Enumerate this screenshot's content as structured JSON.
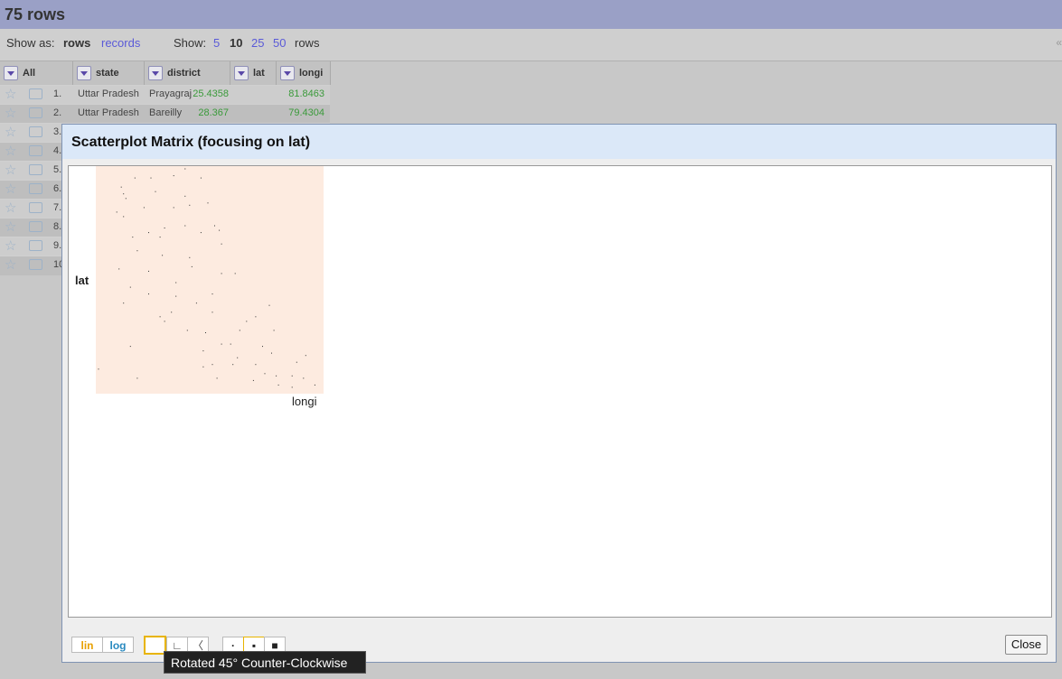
{
  "header": {
    "row_count": "75 rows"
  },
  "toolbar": {
    "show_as_label": "Show as:",
    "show_as_rows": "rows",
    "show_as_records": "records",
    "show_label": "Show:",
    "page_sizes": [
      "5",
      "10",
      "25",
      "50"
    ],
    "page_size_current": "10",
    "rows_suffix": "rows",
    "collapse_glyph": "«"
  },
  "table": {
    "columns": [
      "All",
      "state",
      "district",
      "lat",
      "longi"
    ],
    "visible_index_labels": [
      "1.",
      "2.",
      "3.",
      "4.",
      "5.",
      "6.",
      "7.",
      "8.",
      "9.",
      "10"
    ],
    "rows": [
      {
        "state": "Uttar Pradesh",
        "district": "Prayagraj",
        "lat": "25.4358",
        "longi": "81.8463"
      },
      {
        "state": "Uttar Pradesh",
        "district": "Bareilly",
        "lat": "28.367",
        "longi": "79.4304"
      }
    ]
  },
  "dialog": {
    "title": "Scatterplot Matrix (focusing on lat)",
    "close_label": "Close",
    "scale_lin": "lin",
    "scale_log": "log",
    "rotation_glyphs": [
      "",
      "∟",
      "〈"
    ],
    "dot_size_glyphs": [
      "·",
      "▪",
      "■"
    ]
  },
  "tooltip": {
    "text": "Rotated 45° Counter-Clockwise"
  },
  "chart_data": {
    "type": "scatter",
    "title": "",
    "xlabel": "longi",
    "ylabel": "lat",
    "points": [
      [
        0.01,
        0.89
      ],
      [
        0.18,
        0.93
      ],
      [
        0.12,
        0.12
      ],
      [
        0.17,
        0.05
      ],
      [
        0.24,
        0.05
      ],
      [
        0.34,
        0.04
      ],
      [
        0.39,
        0.01
      ],
      [
        0.46,
        0.05
      ],
      [
        0.11,
        0.09
      ],
      [
        0.26,
        0.11
      ],
      [
        0.39,
        0.13
      ],
      [
        0.13,
        0.14
      ],
      [
        0.21,
        0.18
      ],
      [
        0.34,
        0.18
      ],
      [
        0.41,
        0.17
      ],
      [
        0.49,
        0.16
      ],
      [
        0.09,
        0.2
      ],
      [
        0.12,
        0.22
      ],
      [
        0.23,
        0.29
      ],
      [
        0.28,
        0.31
      ],
      [
        0.3,
        0.27
      ],
      [
        0.39,
        0.26
      ],
      [
        0.46,
        0.29
      ],
      [
        0.52,
        0.26
      ],
      [
        0.54,
        0.28
      ],
      [
        0.55,
        0.34
      ],
      [
        0.16,
        0.31
      ],
      [
        0.18,
        0.37
      ],
      [
        0.29,
        0.39
      ],
      [
        0.41,
        0.4
      ],
      [
        0.42,
        0.44
      ],
      [
        0.1,
        0.45
      ],
      [
        0.23,
        0.46
      ],
      [
        0.55,
        0.47
      ],
      [
        0.61,
        0.47
      ],
      [
        0.15,
        0.53
      ],
      [
        0.23,
        0.56
      ],
      [
        0.35,
        0.51
      ],
      [
        0.51,
        0.56
      ],
      [
        0.35,
        0.57
      ],
      [
        0.12,
        0.6
      ],
      [
        0.44,
        0.6
      ],
      [
        0.76,
        0.61
      ],
      [
        0.33,
        0.64
      ],
      [
        0.51,
        0.64
      ],
      [
        0.28,
        0.66
      ],
      [
        0.7,
        0.66
      ],
      [
        0.66,
        0.68
      ],
      [
        0.63,
        0.72
      ],
      [
        0.78,
        0.72
      ],
      [
        0.4,
        0.72
      ],
      [
        0.48,
        0.73
      ],
      [
        0.55,
        0.78
      ],
      [
        0.59,
        0.78
      ],
      [
        0.73,
        0.79
      ],
      [
        0.3,
        0.68
      ],
      [
        0.15,
        0.79
      ],
      [
        0.92,
        0.83
      ],
      [
        0.47,
        0.81
      ],
      [
        0.62,
        0.84
      ],
      [
        0.77,
        0.82
      ],
      [
        0.7,
        0.87
      ],
      [
        0.51,
        0.87
      ],
      [
        0.6,
        0.87
      ],
      [
        0.88,
        0.86
      ],
      [
        0.47,
        0.88
      ],
      [
        0.74,
        0.91
      ],
      [
        0.79,
        0.92
      ],
      [
        0.86,
        0.92
      ],
      [
        0.91,
        0.93
      ],
      [
        0.53,
        0.93
      ],
      [
        0.69,
        0.94
      ],
      [
        0.8,
        0.96
      ],
      [
        0.86,
        0.97
      ],
      [
        0.96,
        0.96
      ]
    ]
  }
}
